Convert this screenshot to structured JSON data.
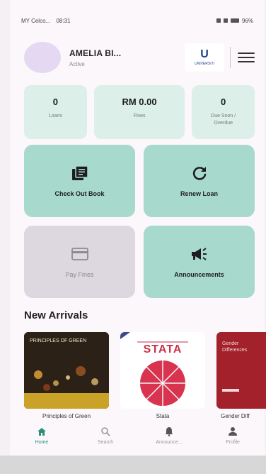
{
  "status_bar": {
    "carrier": "MY Celco...",
    "time": "08:31",
    "battery": "96%"
  },
  "header": {
    "user_name": "AMELIA BI...",
    "user_role": "Active",
    "logo_letter": "U",
    "logo_text": "UNIVERSITI"
  },
  "stats": [
    {
      "value": "0",
      "label": "Loans"
    },
    {
      "value": "RM 0.00",
      "label": "Fines"
    },
    {
      "value": "0",
      "label": "Due Soon / Overdue"
    }
  ],
  "actions": [
    {
      "label": "Check Out Book",
      "icon": "library-books-icon",
      "enabled": true
    },
    {
      "label": "Renew Loan",
      "icon": "refresh-icon",
      "enabled": true
    },
    {
      "label": "Pay Fines",
      "icon": "credit-card-icon",
      "enabled": false
    },
    {
      "label": "Announcements",
      "icon": "megaphone-icon",
      "enabled": true
    }
  ],
  "new_arrivals": {
    "title": "New Arrivals",
    "books": [
      {
        "title": "Principles of Green",
        "cover_text": "PRINCIPLES OF GREEN"
      },
      {
        "title": "Stata",
        "cover_text": "STATA"
      },
      {
        "title": "Gender Diff",
        "cover_text": "Gender Differences"
      }
    ]
  },
  "bottom_nav": [
    {
      "label": "Home",
      "icon": "home-icon",
      "active": true
    },
    {
      "label": "Search",
      "icon": "search-icon",
      "active": false
    },
    {
      "label": "Announce...",
      "icon": "bell-icon",
      "active": false
    },
    {
      "label": "Profile",
      "icon": "person-icon",
      "active": false
    }
  ],
  "colors": {
    "accent_tile": "#a7d9cd",
    "stat_bg": "#dcefe9",
    "active_nav": "#2c8f7b",
    "disabled_tile": "#ddd7df"
  }
}
